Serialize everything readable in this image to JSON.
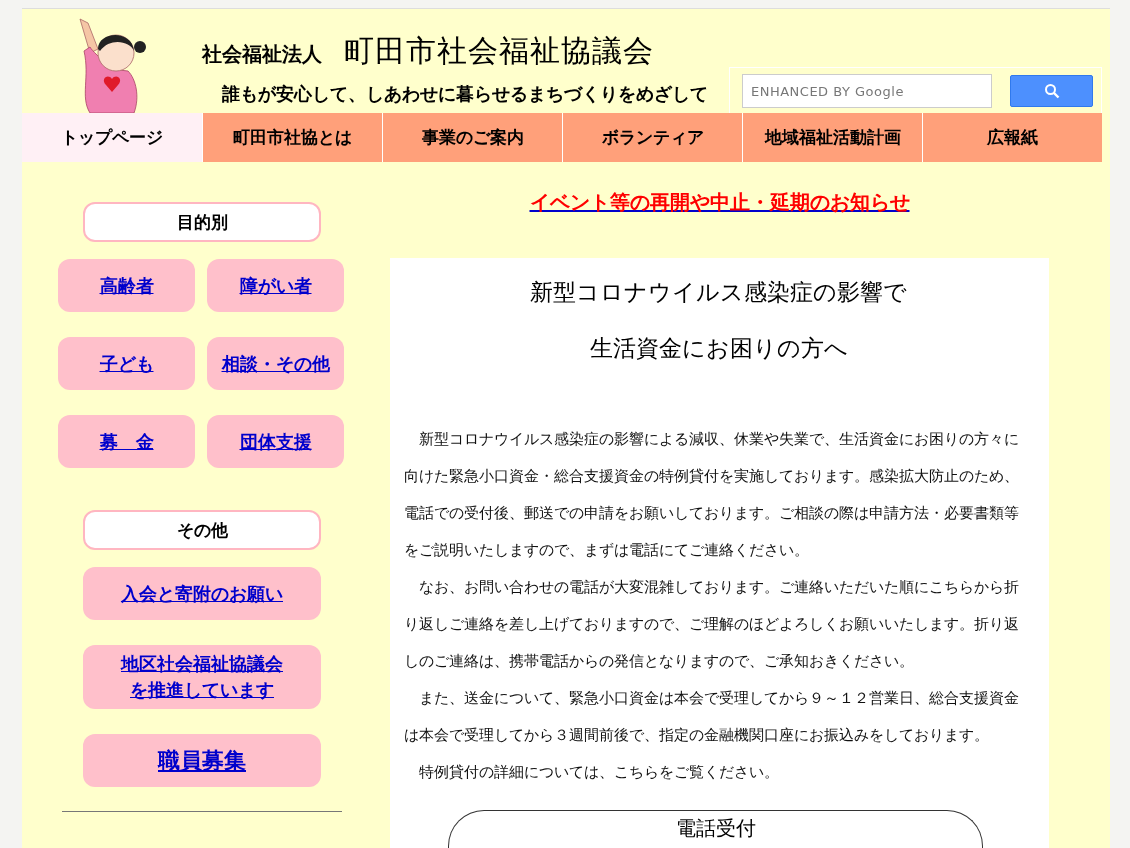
{
  "header": {
    "org_type": "社会福祉法人",
    "org_name": "町田市社会福祉協議会",
    "tagline": "誰もが安心して、しあわせに暮らせるまちづくりをめざして"
  },
  "search": {
    "placeholder": "ENHANCED BY Google"
  },
  "nav": [
    {
      "label": "トップページ",
      "selected": true
    },
    {
      "label": "町田市社協とは",
      "selected": false
    },
    {
      "label": "事業のご案内",
      "selected": false
    },
    {
      "label": "ボランティア",
      "selected": false
    },
    {
      "label": "地域福祉活動計画",
      "selected": false
    },
    {
      "label": "広報紙",
      "selected": false
    }
  ],
  "sidebar": {
    "sections": [
      {
        "title": "目的別",
        "kind": "grid",
        "links": [
          {
            "lines": [
              "高齢者"
            ],
            "kind": "normal"
          },
          {
            "lines": [
              "障がい者"
            ],
            "kind": "normal"
          },
          {
            "lines": [
              "子ども"
            ],
            "kind": "normal"
          },
          {
            "lines": [
              "相談・その他"
            ],
            "kind": "normal"
          },
          {
            "lines": [
              "募　金"
            ],
            "kind": "normal"
          },
          {
            "lines": [
              "団体支援"
            ],
            "kind": "normal"
          }
        ]
      },
      {
        "title": "その他",
        "kind": "list",
        "links": [
          {
            "lines": [
              "入会と寄附のお願い"
            ],
            "kind": "normal"
          },
          {
            "lines": [
              "地区社会福祉協議会",
              "を推進しています"
            ],
            "kind": "normal"
          },
          {
            "lines": [
              "職員募集"
            ],
            "kind": "large"
          }
        ]
      }
    ]
  },
  "notice": {
    "text": "イベント等の再開や中止・延期のお知らせ"
  },
  "article": {
    "title_lines": [
      "新型コロナウイルス感染症の影響で",
      "生活資金にお困りの方へ"
    ],
    "paragraphs": [
      "新型コロナウイルス感染症の影響による減収、休業や失業で、生活資金にお困りの方々に向けた緊急小口資金・総合支援資金の特例貸付を実施しております。感染拡大防止のため、電話での受付後、郵送での申請をお願いしております。ご相談の際は申請方法・必要書類等をご説明いたしますので、まずは電話にてご連絡ください。",
      "なお、お問い合わせの電話が大変混雑しております。ご連絡いただいた順にこちらから折り返しご連絡を差し上げておりますので、ご理解のほどよろしくお願いいたします。折り返しのご連絡は、携帯電話からの発信となりますので、ご承知おきください。",
      "また、送金について、緊急小口資金は本会で受理してから９～１２営業日、総合支援資金は本会で受理してから３週間前後で、指定の金融機関口座にお振込みをしております。",
      "特例貸付の詳細については、こちらをご覧ください。"
    ],
    "box_title": "電話受付"
  }
}
